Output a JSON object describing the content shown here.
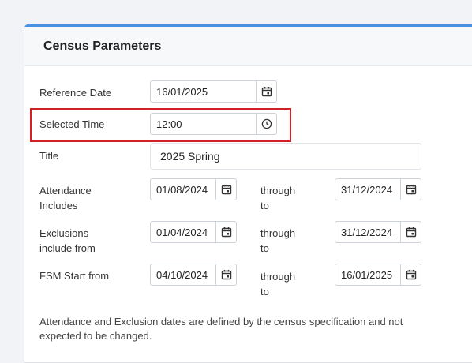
{
  "panel": {
    "title": "Census Parameters"
  },
  "reference_date": {
    "label": "Reference Date",
    "value": "16/01/2025",
    "icon": "calendar-icon"
  },
  "selected_time": {
    "label": "Selected Time",
    "value": "12:00",
    "icon": "clock-icon"
  },
  "title_field": {
    "label": "Title",
    "value": "2025 Spring"
  },
  "attendance": {
    "label_line1": "Attendance",
    "label_line2": "Includes",
    "from": "01/08/2024",
    "through_line1": "through",
    "through_line2": "to",
    "to": "31/12/2024"
  },
  "exclusions": {
    "label_line1": "Exclusions",
    "label_line2": "include from",
    "from": "01/04/2024",
    "through_line1": "through",
    "through_line2": "to",
    "to": "31/12/2024"
  },
  "fsm": {
    "label_line1": "FSM Start from",
    "from": "04/10/2024",
    "through_line1": "through",
    "through_line2": "to",
    "to": "16/01/2025"
  },
  "note": {
    "line1": "Attendance and Exclusion dates are defined by the census specification and not",
    "line2": "expected to be changed."
  },
  "colors": {
    "accent": "#4a90e2",
    "highlight": "#d32027"
  }
}
